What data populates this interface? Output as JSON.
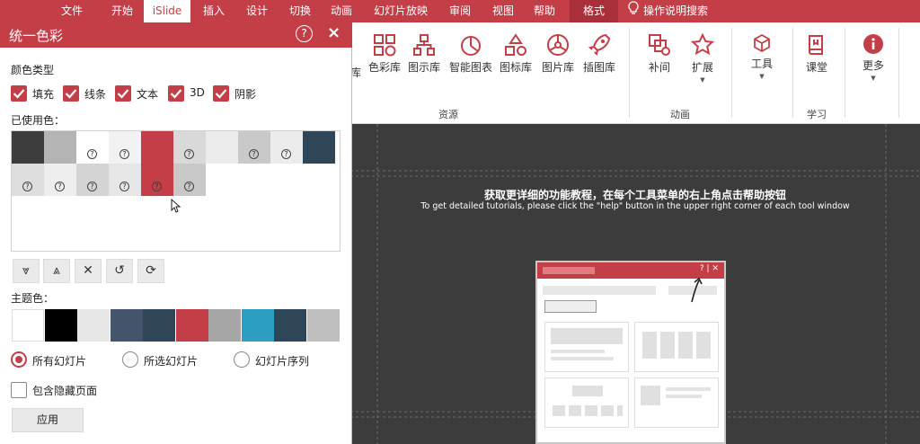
{
  "ribbon": {
    "tabs": [
      {
        "label": "文件",
        "active": false
      },
      {
        "label": "开始",
        "active": false
      },
      {
        "label": "iSlide",
        "active": true
      },
      {
        "label": "插入",
        "active": false
      },
      {
        "label": "设计",
        "active": false
      },
      {
        "label": "切换",
        "active": false
      },
      {
        "label": "动画",
        "active": false
      },
      {
        "label": "幻灯片放映",
        "active": false
      },
      {
        "label": "审阅",
        "active": false
      },
      {
        "label": "视图",
        "active": false
      },
      {
        "label": "帮助",
        "active": false
      },
      {
        "label": "格式",
        "active": false
      }
    ],
    "tell_me": "操作说明搜索",
    "resources": {
      "partial_label": "库",
      "buttons": [
        "色彩库",
        "图示库",
        "智能图表",
        "图标库",
        "图片库",
        "插图库"
      ],
      "group_label": "资源"
    },
    "animation": {
      "buttons": [
        "补间",
        "扩展"
      ],
      "group_label": "动画"
    },
    "tools_label": "工具",
    "learning": {
      "buttons": [
        "课堂"
      ],
      "group_label": "学习"
    },
    "more_label": "更多"
  },
  "panel": {
    "title": "统一色彩",
    "color_type_label": "颜色类型",
    "color_types": [
      {
        "label": "填充",
        "checked": true
      },
      {
        "label": "线条",
        "checked": true
      },
      {
        "label": "文本",
        "checked": true
      },
      {
        "label": "3D",
        "checked": true
      },
      {
        "label": "阴影",
        "checked": true
      }
    ],
    "used_colors_label": "已使用色：",
    "used_colors_row1": [
      {
        "color": "#3d3d3d",
        "q": false
      },
      {
        "color": "#b4b4b4",
        "q": false
      },
      {
        "color": "#ffffff",
        "q": true
      },
      {
        "color": "#f2f2f2",
        "q": true
      },
      {
        "color": "#c43e48",
        "q": false
      },
      {
        "color": "#d9d9d9",
        "q": true
      },
      {
        "color": "#ececec",
        "q": false
      },
      {
        "color": "#c9c9c9",
        "q": true
      },
      {
        "color": "#ececec",
        "q": true
      },
      {
        "color": "#2f4659",
        "q": false
      }
    ],
    "used_colors_row2": [
      {
        "color": "#dedede",
        "q": true
      },
      {
        "color": "#eeeeee",
        "q": true
      },
      {
        "color": "#d4d4d4",
        "q": true
      },
      {
        "color": "#e6e6e6",
        "q": true
      },
      {
        "color": "#c43e48",
        "q": true
      },
      {
        "color": "#c8c8c8",
        "q": true
      }
    ],
    "q_mark": "?",
    "toolbar_glyphs": {
      "down": "⩔",
      "up": "⩓",
      "remove": "✕",
      "undo": "↺",
      "refresh": "⟳"
    },
    "theme_colors_label": "主题色：",
    "theme_colors": [
      "#ffffff",
      "#000000",
      "#e7e6e6",
      "#44546a",
      "#2f4659",
      "#c43e48",
      "#a6a6a6",
      "#2c9ec2",
      "#2f4659",
      "#bfbfbf"
    ],
    "scope_options": [
      {
        "label": "所有幻灯片",
        "selected": true
      },
      {
        "label": "所选幻灯片",
        "selected": false
      },
      {
        "label": "幻灯片序列",
        "selected": false
      }
    ],
    "include_hidden_label": "包含隐藏页面",
    "include_hidden_checked": false,
    "apply_label": "应用"
  },
  "slide": {
    "help_title": "获取更详细的功能教程，在每个工具菜单的右上角点击帮助按钮",
    "help_subtitle": "To get detailed tutorials, please click the \"help\" button in the upper right corner of each tool window",
    "mockup_buttons": "? | ✕"
  },
  "colors": {
    "accent": "#c43e48",
    "slide_bg": "#3c3c3c"
  }
}
